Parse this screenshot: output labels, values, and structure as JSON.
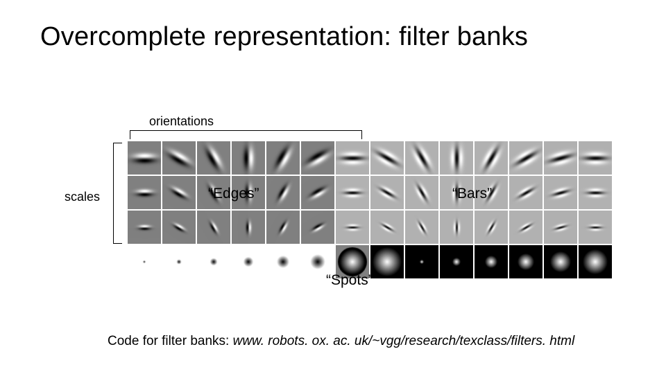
{
  "title": "Overcomplete representation: filter banks",
  "labels": {
    "orientations": "orientations",
    "scales": "scales",
    "edges": "“Edges”",
    "bars": "“Bars”",
    "spots": "“Spots”"
  },
  "footer": {
    "prefix": "Code for filter banks: ",
    "url": "www. robots. ox. ac. uk/~vgg/research/texclass/filters. html"
  },
  "filterbank": {
    "tile": 48,
    "orientations_deg": [
      0,
      30,
      60,
      90,
      120,
      150
    ],
    "scales_sigma": [
      3.5,
      2.5,
      1.8
    ],
    "edges": {
      "type": "odd_bar"
    },
    "bars": {
      "type": "even_bar"
    },
    "spots": [
      {
        "type": "log",
        "sigma": 2,
        "bg": "white"
      },
      {
        "type": "log",
        "sigma": 4,
        "bg": "white"
      },
      {
        "type": "log",
        "sigma": 6,
        "bg": "white"
      },
      {
        "type": "log",
        "sigma": 8,
        "bg": "white"
      },
      {
        "type": "log",
        "sigma": 10,
        "bg": "white"
      },
      {
        "type": "log",
        "sigma": 12,
        "bg": "white"
      },
      {
        "type": "log",
        "sigma": 14,
        "bg": "gray"
      },
      {
        "type": "log",
        "sigma": 14,
        "bg": "black"
      },
      {
        "type": "gauss",
        "sigma": 2,
        "bg": "black"
      },
      {
        "type": "gauss",
        "sigma": 4,
        "bg": "black"
      },
      {
        "type": "gauss",
        "sigma": 6,
        "bg": "black"
      },
      {
        "type": "gauss",
        "sigma": 8,
        "bg": "black"
      },
      {
        "type": "gauss",
        "sigma": 10,
        "bg": "black"
      },
      {
        "type": "gauss",
        "sigma": 12,
        "bg": "black"
      }
    ]
  }
}
